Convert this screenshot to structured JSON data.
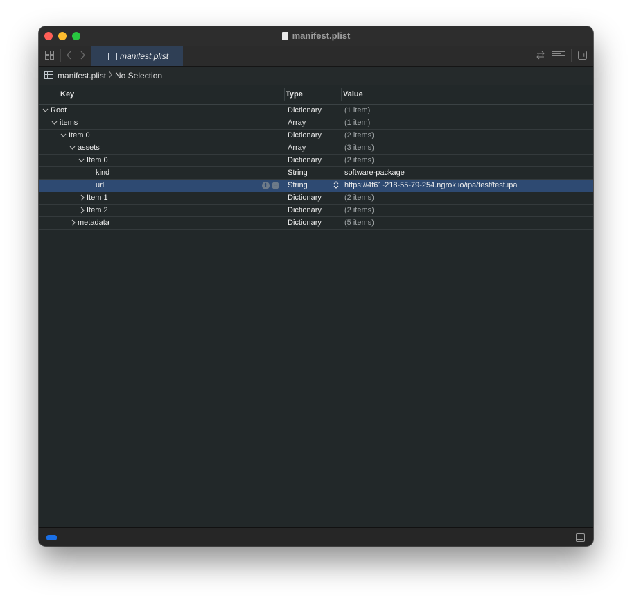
{
  "window": {
    "title": "manifest.plist"
  },
  "toolbar": {
    "tab_label": "manifest.plist",
    "icons": [
      "grid-icon",
      "back-icon",
      "forward-icon",
      "swap-icon",
      "text-lines-icon",
      "add-panel-icon"
    ]
  },
  "jumpbar": {
    "file": "manifest.plist",
    "selection": "No Selection"
  },
  "columns": {
    "key": "Key",
    "type": "Type",
    "value": "Value"
  },
  "rows": [
    {
      "key": "Root",
      "type": "Dictionary",
      "value": "(1 item)",
      "expander": "expanded"
    },
    {
      "key": "items",
      "type": "Array",
      "value": "(1 item)",
      "expander": "expanded"
    },
    {
      "key": "Item 0",
      "type": "Dictionary",
      "value": "(2 items)",
      "expander": "expanded"
    },
    {
      "key": "assets",
      "type": "Array",
      "value": "(3 items)",
      "expander": "expanded"
    },
    {
      "key": "Item 0",
      "type": "Dictionary",
      "value": "(2 items)",
      "expander": "expanded"
    },
    {
      "key": "kind",
      "type": "String",
      "value": "software-package",
      "expander": "none"
    },
    {
      "key": "url",
      "type": "String",
      "value": "https://4f61-218-55-79-254.ngrok.io/ipa/test/test.ipa",
      "expander": "none",
      "selected": true
    },
    {
      "key": "Item 1",
      "type": "Dictionary",
      "value": "(2 items)",
      "expander": "collapsed"
    },
    {
      "key": "Item 2",
      "type": "Dictionary",
      "value": "(2 items)",
      "expander": "collapsed"
    },
    {
      "key": "metadata",
      "type": "Dictionary",
      "value": "(5 items)",
      "expander": "collapsed"
    }
  ],
  "colors": {
    "selection": "#2e4a72",
    "tab_active": "#2f3f55",
    "background": "#222829",
    "close": "#ff5f57",
    "minimize": "#febc2e",
    "zoom": "#28c840",
    "status_accent": "#1a6fe6"
  }
}
